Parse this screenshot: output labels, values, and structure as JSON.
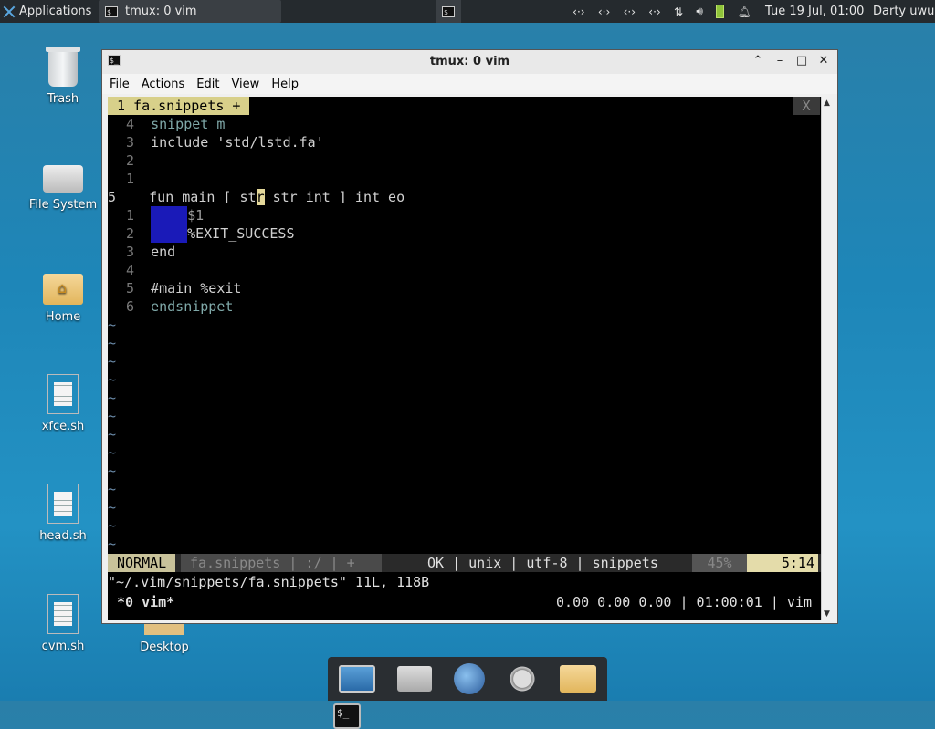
{
  "panel": {
    "applications_label": "Applications",
    "task_label": "tmux: 0 vim",
    "clock": "Tue 19 Jul, 01:00",
    "user": "Darty uwu",
    "tray_icons": [
      "network-icon",
      "network-icon",
      "network-icon",
      "network-icon",
      "updown-icon",
      "volume-icon",
      "battery-icon",
      "bell-icon"
    ]
  },
  "desktop": {
    "icons": [
      {
        "label": "Trash"
      },
      {
        "label": "File System"
      },
      {
        "label": "Home"
      },
      {
        "label": "xfce.sh"
      },
      {
        "label": "head.sh"
      },
      {
        "label": "cvm.sh"
      },
      {
        "label": "Desktop"
      }
    ]
  },
  "window": {
    "title": "tmux: 0 vim",
    "menu": [
      "File",
      "Actions",
      "Edit",
      "View",
      "Help"
    ]
  },
  "vim": {
    "tab_label": "1 fa.snippets +",
    "tab_close": "X",
    "lines": [
      {
        "num": "4",
        "text": "snippet m"
      },
      {
        "num": "3",
        "text": "include 'std/lstd.fa'"
      },
      {
        "num": "2",
        "text": ""
      },
      {
        "num": "1",
        "text": ""
      },
      {
        "num": "5",
        "text_before": "fun main [ st",
        "cursor": "r",
        "text_after": " str int ] int eo"
      },
      {
        "num": "1",
        "text": "$1"
      },
      {
        "num": "2",
        "text": "%EXIT_SUCCESS"
      },
      {
        "num": "3",
        "text": "end"
      },
      {
        "num": "4",
        "text": ""
      },
      {
        "num": "5",
        "text": "#main %exit"
      },
      {
        "num": "6",
        "text": "endsnippet"
      }
    ],
    "tilde": "~",
    "status": {
      "mode": "NORMAL",
      "file": "fa.snippets  | :/  |  +",
      "info": "OK | unix | utf-8 | snippets",
      "percent": "45%",
      "position": "5:14"
    },
    "message": "\"~/.vim/snippets/fa.snippets\" 11L, 118B"
  },
  "tmux": {
    "window": "*0 vim*",
    "right": "0.00 0.00 0.00 | 01:00:01 | vim"
  }
}
